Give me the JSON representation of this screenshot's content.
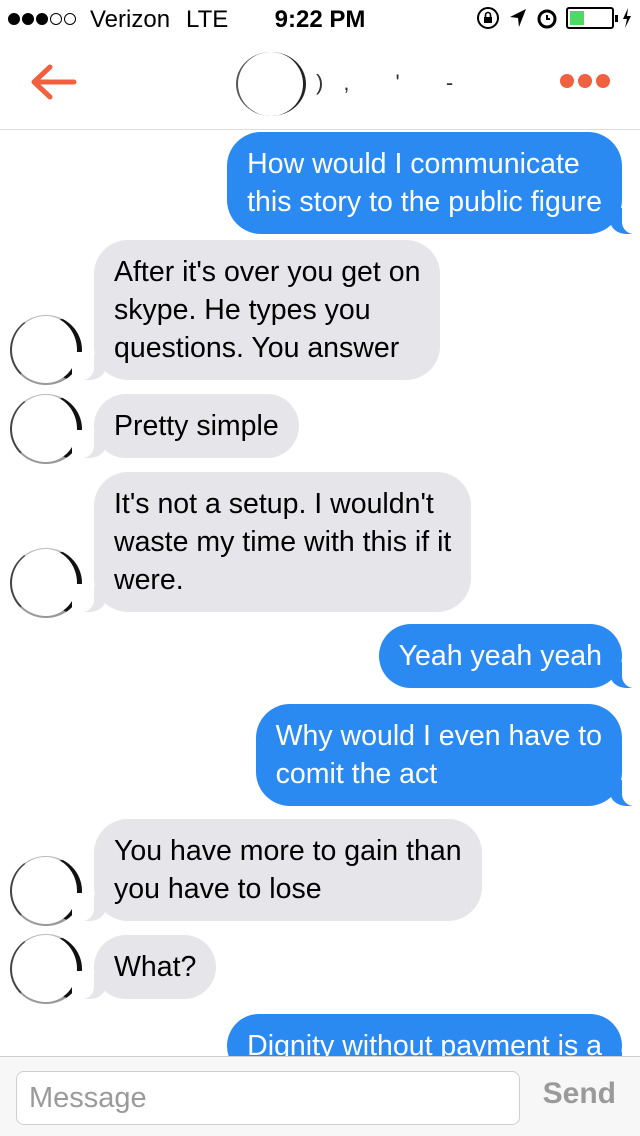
{
  "status_bar": {
    "carrier": "Verizon",
    "network": "LTE",
    "time": "9:22 PM",
    "signal_bars_filled": 3,
    "signal_bars_total": 5,
    "battery_level": 0.35,
    "icons": [
      "orientation-lock-icon",
      "location-arrow-icon",
      "alarm-icon",
      "battery-icon",
      "charging-bolt-icon"
    ]
  },
  "nav": {
    "back_icon": "arrow-left-icon",
    "more_icon": "ellipsis-icon",
    "accent_color": "#f1603f",
    "title_marks": "), ' -"
  },
  "messages": [
    {
      "direction": "out",
      "text": "How would I communicate\nthis story to the public figure"
    },
    {
      "direction": "in",
      "text": "After it's over you get on\nskype. He types you\nquestions. You answer",
      "avatar": true
    },
    {
      "direction": "in",
      "text": "Pretty simple",
      "avatar": true
    },
    {
      "direction": "in",
      "text": "It's not a setup. I wouldn't\nwaste my time with this if it\nwere.",
      "avatar": true
    },
    {
      "direction": "out",
      "text": "Yeah yeah yeah"
    },
    {
      "direction": "out",
      "text": "Why would I even have to\ncomit the act"
    },
    {
      "direction": "in",
      "text": "You have more to gain than\nyou have to lose",
      "avatar": true
    },
    {
      "direction": "in",
      "text": "What?",
      "avatar": true
    },
    {
      "direction": "out",
      "text": "Dignity without payment is a"
    }
  ],
  "input": {
    "placeholder": "Message",
    "value": "",
    "send_label": "Send"
  },
  "colors": {
    "outgoing_bubble": "#2a8af2",
    "incoming_bubble": "#e5e5ea"
  }
}
